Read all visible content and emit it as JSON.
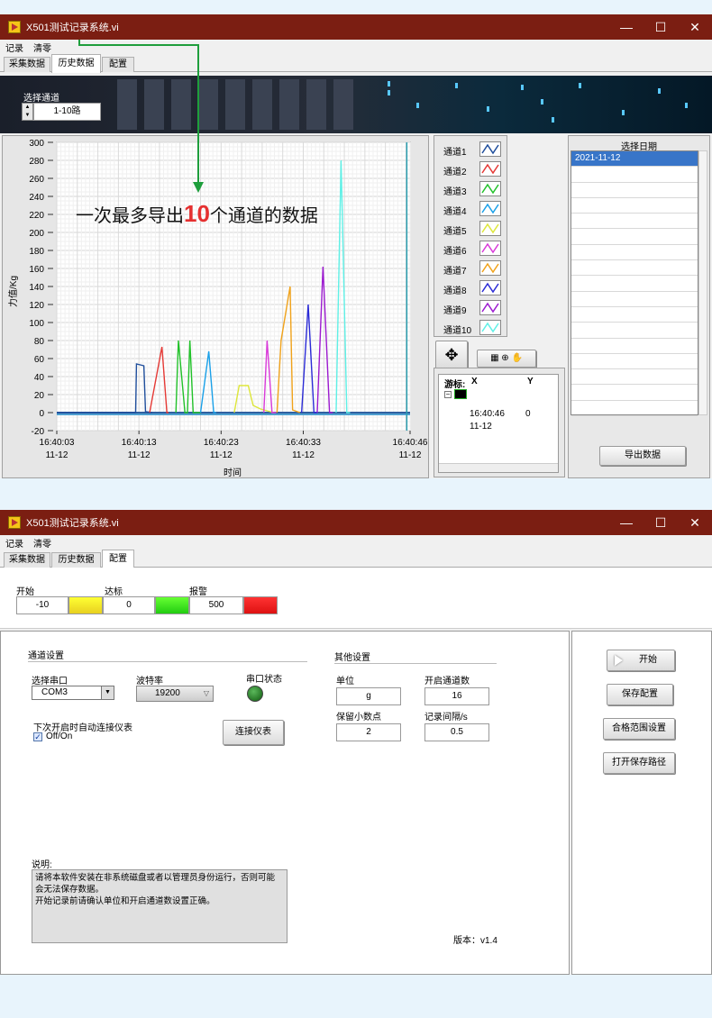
{
  "top": {
    "title": "X501测试记录系统.vi",
    "menu": [
      "记录",
      "清零"
    ],
    "tabs": [
      "采集数据",
      "历史数据",
      "配置"
    ],
    "channel_select": {
      "label": "选择通道",
      "value": "1-10路"
    },
    "annotation": {
      "before": "一次最多导出",
      "num": "10",
      "after": "个通道的数据"
    },
    "legend": [
      "通道1",
      "通道2",
      "通道3",
      "通道4",
      "通道5",
      "通道6",
      "通道7",
      "通道8",
      "通道9",
      "通道10"
    ],
    "cursor": {
      "col_label": "游标:",
      "col_x": "X",
      "col_y": "Y",
      "time": "16:40:46",
      "date": "11-12",
      "y": "0"
    },
    "date_list": {
      "header": "选择日期",
      "items": [
        "2021-11-12"
      ]
    },
    "export_button": "导出数据",
    "chart_data": {
      "type": "line",
      "ylabel": "力值/Kg",
      "xlabel": "时间",
      "ylim": [
        -20,
        300
      ],
      "yticks": [
        "300",
        "280",
        "260",
        "240",
        "220",
        "200",
        "180",
        "160",
        "140",
        "120",
        "100",
        "80",
        "60",
        "40",
        "20",
        "0",
        "-20"
      ],
      "xtick_labels": [
        {
          "t": "16:40:03",
          "d": "11-12"
        },
        {
          "t": "16:40:13",
          "d": "11-12"
        },
        {
          "t": "16:40:23",
          "d": "11-12"
        },
        {
          "t": "16:40:33",
          "d": "11-12"
        },
        {
          "t": "16:40:46",
          "d": "11-12"
        }
      ],
      "colors": [
        "#1f4e9c",
        "#e53935",
        "#22c22a",
        "#1aa0e8",
        "#dde63a",
        "#d93ad9",
        "#f0a21a",
        "#2b2bd6",
        "#9c1ad0",
        "#5ef0e6"
      ],
      "series": [
        {
          "name": "通道1",
          "x": [
            0,
            9.6,
            9.7,
            10.6,
            10.8,
            11.6
          ],
          "y": [
            0,
            0,
            54,
            52,
            1,
            0
          ]
        },
        {
          "name": "通道2",
          "x": [
            11.3,
            12.8,
            13.4,
            13.6
          ],
          "y": [
            0,
            73,
            0,
            0
          ]
        },
        {
          "name": "通道3",
          "x": [
            14.5,
            14.8,
            15.6,
            15.9,
            16.2,
            16.6,
            16.8,
            17.5
          ],
          "y": [
            0,
            80,
            0,
            0,
            80,
            0,
            0,
            0
          ]
        },
        {
          "name": "通道4",
          "x": [
            17.5,
            18.5,
            19.1,
            19.4
          ],
          "y": [
            0,
            68,
            0,
            0
          ]
        },
        {
          "name": "通道5",
          "x": [
            21.6,
            22.2,
            23.3,
            23.9,
            24.8,
            26.4
          ],
          "y": [
            0,
            30,
            30,
            8,
            4,
            0
          ]
        },
        {
          "name": "通道6",
          "x": [
            25.2,
            25.6,
            26.2,
            26.7
          ],
          "y": [
            0,
            80,
            0,
            0
          ]
        },
        {
          "name": "通道7",
          "x": [
            26.8,
            27.3,
            28.4,
            28.7,
            29.6
          ],
          "y": [
            0,
            80,
            140,
            3,
            0
          ]
        },
        {
          "name": "通道8",
          "x": [
            29.8,
            30.6,
            31.3,
            31.7
          ],
          "y": [
            0,
            120,
            0,
            0
          ]
        },
        {
          "name": "通道9",
          "x": [
            31.7,
            32.4,
            33.2,
            33.6
          ],
          "y": [
            0,
            162,
            0,
            0
          ]
        },
        {
          "name": "通道10",
          "x": [
            34.0,
            34.6,
            35.3,
            35.7
          ],
          "y": [
            0,
            280,
            0,
            0
          ]
        }
      ],
      "flat_lines": [
        {
          "color": "#3060a0",
          "x": [
            0,
            43
          ],
          "y": [
            0,
            0
          ]
        },
        {
          "color": "#4fa0d0",
          "x": [
            0,
            43
          ],
          "y": [
            -2,
            -2
          ]
        }
      ]
    }
  },
  "bottom": {
    "title": "X501测试记录系统.vi",
    "menu": [
      "记录",
      "清零"
    ],
    "tabs": [
      "采集数据",
      "历史数据",
      "配置"
    ],
    "levels": {
      "start_label": "开始",
      "start_value": "-10",
      "target_label": "达标",
      "target_value": "0",
      "alarm_label": "报警",
      "alarm_value": "500",
      "colors": {
        "yellow": "#ffff33",
        "green": "#44ee22",
        "red": "#ff2222"
      }
    },
    "channel_settings": {
      "section": "通道设置",
      "port_label": "选择串口",
      "port_value": "COM3",
      "baud_label": "波特率",
      "baud_value": "19200",
      "status_label": "串口状态",
      "autoconnect_label": "下次开启时自动连接仪表",
      "autoconnect_value": "Off/On",
      "connect_button": "连接仪表"
    },
    "other_settings": {
      "section": "其他设置",
      "unit_label": "单位",
      "unit_value": "g",
      "channels_label": "开启通道数",
      "channels_value": "16",
      "decimals_label": "保留小数点",
      "decimals_value": "2",
      "interval_label": "记录间隔/s",
      "interval_value": "0.5"
    },
    "notes": {
      "label": "说明:",
      "line1": "请将本软件安装在非系统磁盘或者以管理员身份运行，否则可能",
      "line2": "会无法保存数据。",
      "line3": "开始记录前请确认单位和开启通道数设置正确。"
    },
    "version": "版本：v1.4",
    "buttons": {
      "start": "开始",
      "save_config": "保存配置",
      "range": "合格范围设置",
      "open_path": "打开保存路径"
    }
  }
}
